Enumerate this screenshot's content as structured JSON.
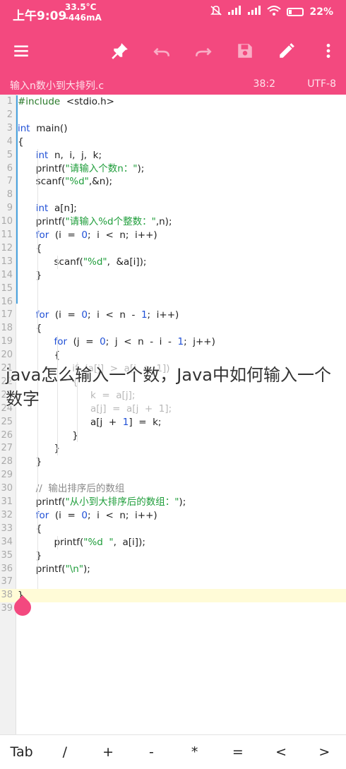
{
  "status_bar": {
    "time": "上午9:09",
    "temperature": "33.5°C",
    "network_speed": "-446mA",
    "battery": "22%"
  },
  "toolbar": {
    "icons": [
      "menu-icon",
      "pin-icon",
      "undo-icon",
      "redo-icon",
      "save-icon",
      "edit-icon",
      "more-icon"
    ]
  },
  "file_bar": {
    "filename": "输入n数小到大排列.c",
    "cursor_position": "38:2",
    "encoding": "UTF-8"
  },
  "editor": {
    "line_numbers": [
      "1",
      "2",
      "3",
      "4",
      "5",
      "6",
      "7",
      "8",
      "9",
      "10",
      "11",
      "12",
      "13",
      "14",
      "15",
      "16",
      "17",
      "18",
      "19",
      "20",
      "21",
      "22",
      "23",
      "24",
      "25",
      "26",
      "27",
      "28",
      "29",
      "30",
      "31",
      "32",
      "33",
      "34",
      "35",
      "36",
      "37",
      "38",
      "39"
    ],
    "lines": [
      "#include  <stdio.h>",
      "",
      "int  main()",
      "{",
      "      int  n,  i,  j,  k;",
      "      printf(\"请输入个数n：\");",
      "      scanf(\"%d\",&n);",
      "",
      "      int  a[n];",
      "      printf(\"请输入%d个整数：\",n);",
      "      for  (i  =  0;  i  <  n;  i++)",
      "      {",
      "            scanf(\"%d\",  &a[i]);",
      "      }",
      "",
      "",
      "      for  (i  =  0;  i  <  n  -  1;  i++)",
      "      {",
      "            for  (j  =  0;  j  <  n  -  i  -  1;  j++)",
      "            {",
      "                  if  (a[j]  >  a[j  +  1])",
      "                  {",
      "                        k  =  a[j];",
      "                        a[j]  =  a[j  +  1];",
      "                        a[j  +  1]  =  k;",
      "                  }",
      "            }",
      "      }",
      "",
      "      //  输出排序后的数组",
      "      printf(\"从小到大排序后的数组：\");",
      "      for  (i  =  0;  i  <  n;  i++)",
      "      {",
      "            printf(\"%d  \",  a[i]);",
      "      }",
      "      printf(\"\\n\");",
      "",
      "}",
      ""
    ]
  },
  "overlay": {
    "text": "java怎么输入一个数，Java中如何输入一个数字"
  },
  "keybar": {
    "keys": [
      "Tab",
      "/",
      "+",
      "-",
      "*",
      "=",
      "<",
      ">"
    ]
  },
  "colors": {
    "accent": "#f3497f",
    "current_line": "#fffbd7",
    "keyword": "#1f4fd6",
    "string": "#1e9d3a"
  }
}
